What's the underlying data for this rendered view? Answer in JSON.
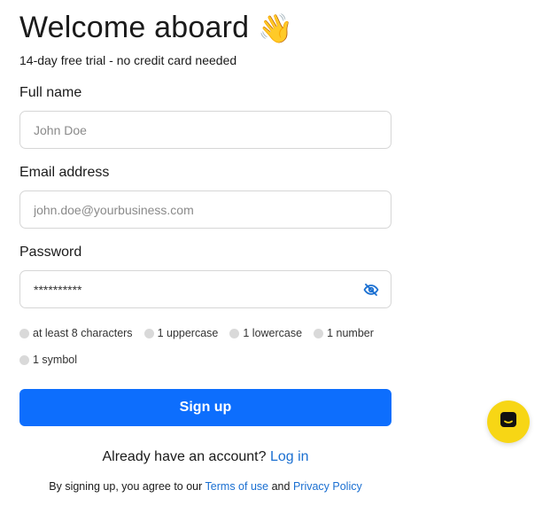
{
  "header": {
    "title": "Welcome aboard",
    "emoji": "👋",
    "subtitle": "14-day free trial - no credit card needed"
  },
  "form": {
    "full_name": {
      "label": "Full name",
      "placeholder": "John Doe"
    },
    "email": {
      "label": "Email address",
      "placeholder": "john.doe@yourbusiness.com"
    },
    "password": {
      "label": "Password",
      "value": "**********",
      "toggle_icon": "eye-off-icon"
    },
    "rules": [
      "at least 8 characters",
      "1 uppercase",
      "1 lowercase",
      "1 number",
      "1 symbol"
    ],
    "submit_label": "Sign up"
  },
  "footer": {
    "have_account": "Already have an account?",
    "login_link": "Log in",
    "terms_prefix": "By signing up, you agree to our",
    "terms_link": "Terms of use",
    "and": "and",
    "privacy_link": "Privacy Policy"
  },
  "chat": {
    "icon": "chat-bubble-icon"
  },
  "colors": {
    "primary": "#0d6efd",
    "link": "#1a6fd1",
    "chat_bg": "#f7d615",
    "rule_dot": "#d9d9d9"
  }
}
